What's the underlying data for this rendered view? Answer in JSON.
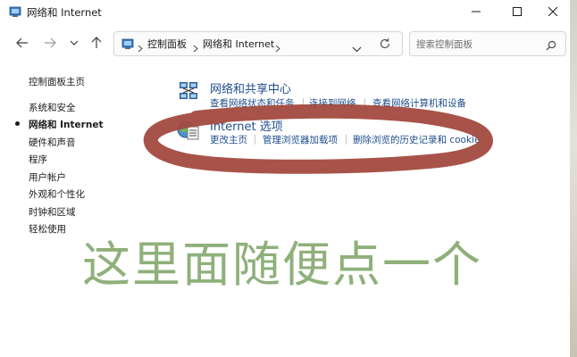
{
  "window": {
    "title": "网络和 Internet",
    "icon": "control-panel-icon"
  },
  "navigation": {
    "breadcrumbs": [
      "控制面板",
      "网络和 Internet"
    ],
    "search_placeholder": "搜索控制面板"
  },
  "sidebar": {
    "items": [
      {
        "label": "控制面板主页",
        "active": false
      },
      {
        "label": "系统和安全",
        "active": false
      },
      {
        "label": "网络和 Internet",
        "active": true
      },
      {
        "label": "硬件和声音",
        "active": false
      },
      {
        "label": "程序",
        "active": false
      },
      {
        "label": "用户帐户",
        "active": false
      },
      {
        "label": "外观和个性化",
        "active": false
      },
      {
        "label": "时钟和区域",
        "active": false
      },
      {
        "label": "轻松使用",
        "active": false
      }
    ]
  },
  "categories": [
    {
      "title": "网络和共享中心",
      "icon": "network-sharing-center-icon",
      "links": [
        "查看网络状态和任务",
        "连接到网络",
        "查看网络计算机和设备"
      ]
    },
    {
      "title": "Internet 选项",
      "icon": "internet-options-icon",
      "links": [
        "更改主页",
        "管理浏览器加载项",
        "删除浏览的历史记录和 cookie"
      ]
    }
  ],
  "annotation": {
    "text": "这里面随便点一个",
    "text_color": "#8fb07a",
    "scribble_color": "#a34a3f"
  },
  "colors": {
    "link": "#1f4e8c",
    "text": "#1b1b1b"
  }
}
